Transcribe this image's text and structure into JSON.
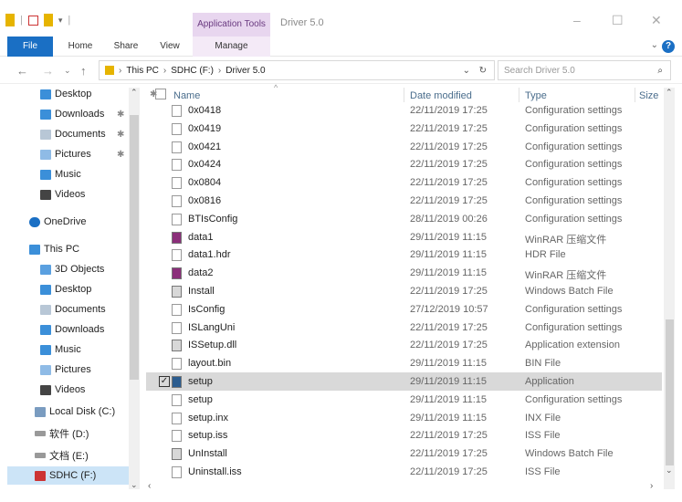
{
  "window": {
    "title": "Driver 5.0",
    "context_tab": "Application Tools"
  },
  "ribbon": {
    "tabs": [
      "File",
      "Home",
      "Share",
      "View",
      "Manage"
    ]
  },
  "address": {
    "path": [
      "This PC",
      "SDHC (F:)",
      "Driver 5.0"
    ],
    "search_placeholder": "Search Driver 5.0"
  },
  "nav": {
    "quick": [
      "Desktop",
      "Downloads",
      "Documents",
      "Pictures",
      "Music",
      "Videos"
    ],
    "onedrive": "OneDrive",
    "thispc": "This PC",
    "pc_items": [
      "3D Objects",
      "Desktop",
      "Documents",
      "Downloads",
      "Music",
      "Pictures",
      "Videos",
      "Local Disk (C:)",
      "软件 (D:)",
      "文档 (E:)",
      "SDHC (F:)"
    ]
  },
  "columns": {
    "name": "Name",
    "date": "Date modified",
    "type": "Type",
    "size": "Size"
  },
  "files": [
    {
      "name": "0x0418",
      "date": "22/11/2019 17:25",
      "type": "Configuration settings"
    },
    {
      "name": "0x0419",
      "date": "22/11/2019 17:25",
      "type": "Configuration settings"
    },
    {
      "name": "0x0421",
      "date": "22/11/2019 17:25",
      "type": "Configuration settings"
    },
    {
      "name": "0x0424",
      "date": "22/11/2019 17:25",
      "type": "Configuration settings"
    },
    {
      "name": "0x0804",
      "date": "22/11/2019 17:25",
      "type": "Configuration settings"
    },
    {
      "name": "0x0816",
      "date": "22/11/2019 17:25",
      "type": "Configuration settings"
    },
    {
      "name": "BTIsConfig",
      "date": "28/11/2019 00:26",
      "type": "Configuration settings"
    },
    {
      "name": "data1",
      "date": "29/11/2019 11:15",
      "type": "WinRAR 压缩文件"
    },
    {
      "name": "data1.hdr",
      "date": "29/11/2019 11:15",
      "type": "HDR File"
    },
    {
      "name": "data2",
      "date": "29/11/2019 11:15",
      "type": "WinRAR 压缩文件"
    },
    {
      "name": "Install",
      "date": "22/11/2019 17:25",
      "type": "Windows Batch File"
    },
    {
      "name": "IsConfig",
      "date": "27/12/2019 10:57",
      "type": "Configuration settings"
    },
    {
      "name": "ISLangUni",
      "date": "22/11/2019 17:25",
      "type": "Configuration settings"
    },
    {
      "name": "ISSetup.dll",
      "date": "22/11/2019 17:25",
      "type": "Application extension"
    },
    {
      "name": "layout.bin",
      "date": "29/11/2019 11:15",
      "type": "BIN File"
    },
    {
      "name": "setup",
      "date": "29/11/2019 11:15",
      "type": "Application"
    },
    {
      "name": "setup",
      "date": "29/11/2019 11:15",
      "type": "Configuration settings"
    },
    {
      "name": "setup.inx",
      "date": "29/11/2019 11:15",
      "type": "INX File"
    },
    {
      "name": "setup.iss",
      "date": "22/11/2019 17:25",
      "type": "ISS File"
    },
    {
      "name": "UnInstall",
      "date": "22/11/2019 17:25",
      "type": "Windows Batch File"
    },
    {
      "name": "Uninstall.iss",
      "date": "22/11/2019 17:25",
      "type": "ISS File"
    }
  ],
  "colors": {
    "accent": "#1a6fc4",
    "context_tab": "#e8d6ef",
    "selected_row": "#d9d9d9"
  }
}
